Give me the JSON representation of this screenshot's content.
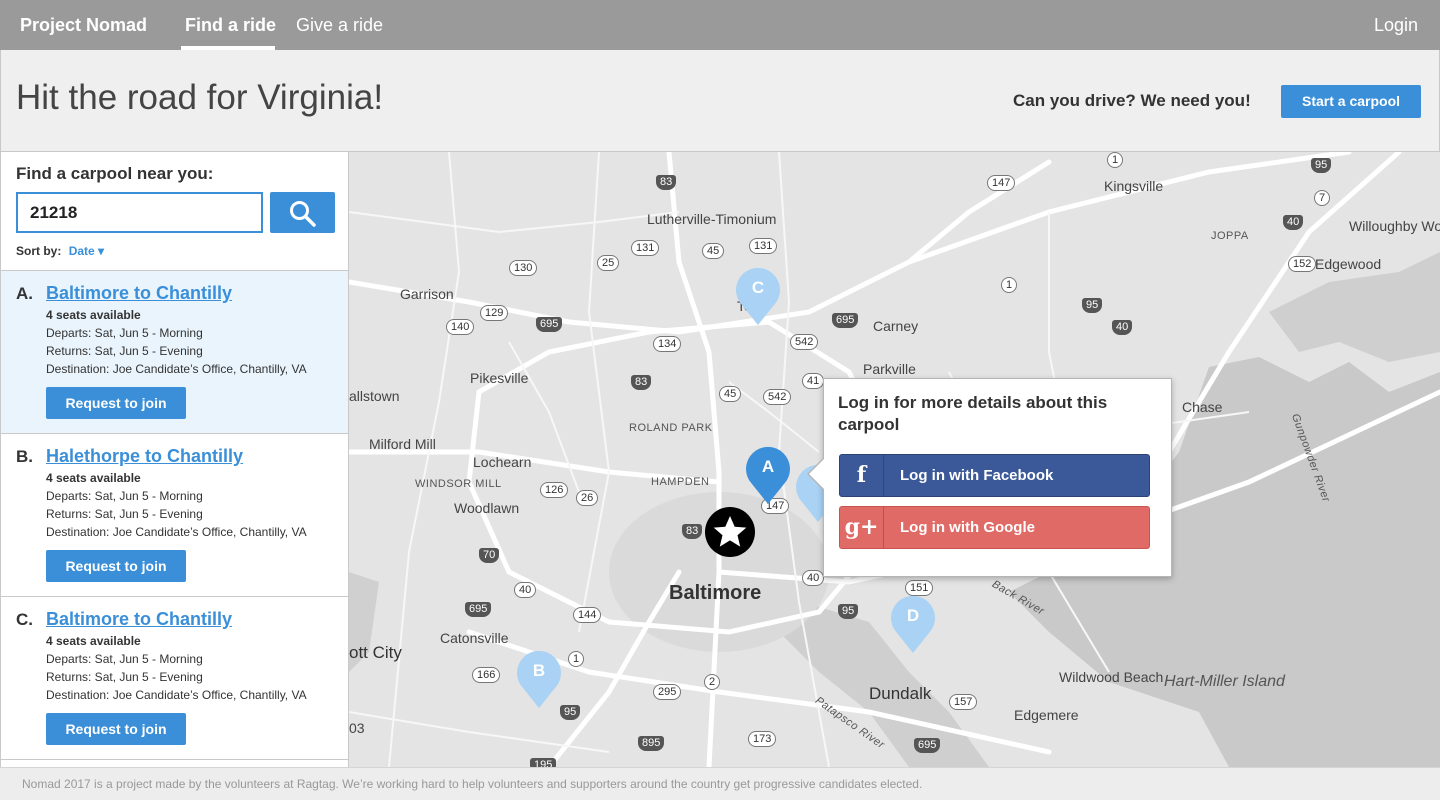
{
  "nav": {
    "brand": "Project Nomad",
    "find_ride": "Find a ride",
    "give_ride": "Give a ride",
    "login": "Login"
  },
  "hero": {
    "title": "Hit the road for Virginia!",
    "drive_prompt": "Can you drive? We need you!",
    "start_button": "Start a carpool"
  },
  "search": {
    "label": "Find a carpool near you:",
    "zip_value": "21218",
    "sort_label": "Sort by:",
    "sort_value": "Date ▾"
  },
  "carpools": [
    {
      "letter": "A.",
      "title": "Baltimore to Chantilly",
      "seats": "4 seats available",
      "departs": "Departs: Sat, Jun 5 - Morning",
      "returns": "Returns: Sat, Jun 5 - Evening",
      "destination": "Destination: Joe Candidate’s Office, Chantilly, VA",
      "button": "Request to join"
    },
    {
      "letter": "B.",
      "title": "Halethorpe to Chantilly",
      "seats": "4 seats available",
      "departs": "Departs: Sat, Jun 5 - Morning",
      "returns": "Returns: Sat, Jun 5 - Evening",
      "destination": "Destination: Joe Candidate’s Office, Chantilly, VA",
      "button": "Request to join"
    },
    {
      "letter": "C.",
      "title": "Baltimore to Chantilly",
      "seats": "4 seats available",
      "departs": "Departs: Sat, Jun 5 - Morning",
      "returns": "Returns: Sat, Jun 5 - Evening",
      "destination": "Destination: Joe Candidate’s Office, Chantilly, VA",
      "button": "Request to join"
    }
  ],
  "map": {
    "pins": [
      "A",
      "B",
      "C",
      "D"
    ],
    "places": {
      "lutherville": "Lutherville-Timonium",
      "kingsville": "Kingsville",
      "willoughby": "Willoughby Woods",
      "edgewood": "Edgewood",
      "joppa": "JOPPA",
      "garrison": "Garrison",
      "towson": "Tow",
      "carney": "Carney",
      "parkville": "Parkville",
      "pikesville": "Pikesville",
      "owings": "allstown",
      "milford": "Milford Mill",
      "lochearn": "Lochearn",
      "roland": "ROLAND PARK",
      "windsor": "WINDSOR MILL",
      "hampden": "HAMPDEN",
      "woodlawn": "Woodlawn",
      "baltimore": "Baltimore",
      "catonsville": "Catonsville",
      "ellicott": "ott City",
      "dundalk": "Dundalk",
      "wildwood": "Wildwood Beach",
      "edgemere": "Edgemere",
      "hartmiller": "Hart-Miller Island",
      "chase": "Chase",
      "backriver": "Back River",
      "gunpowder": "Gunpowder River",
      "patapsco": "Patapsco River"
    },
    "route_shields": [
      "83",
      "1",
      "147",
      "95",
      "7",
      "40",
      "131",
      "45",
      "131",
      "152",
      "130",
      "25",
      "1",
      "129",
      "695",
      "695",
      "95",
      "140",
      "134",
      "542",
      "41",
      "40",
      "83",
      "45",
      "542",
      "126",
      "26",
      "147",
      "83",
      "70",
      "40",
      "40",
      "695",
      "144",
      "95",
      "151",
      "166",
      "1",
      "295",
      "2",
      "95",
      "157",
      "895",
      "173",
      "695",
      "195",
      "03"
    ]
  },
  "popup": {
    "title": "Log in for more details about this carpool",
    "facebook": "Log in with Facebook",
    "google": "Log in with Google",
    "facebook_icon": "f",
    "google_icon": "g+"
  },
  "footer": {
    "text": "Nomad 2017 is a project made by the volunteers at Ragtag. We’re working hard to help volunteers and supporters around the country get progressive candidates elected."
  },
  "colors": {
    "accent": "#3a8fd8",
    "nav_bg": "#9a9a9a",
    "facebook": "#3b5998",
    "google": "#e06a66",
    "pin": "#a9d2f5",
    "pin_active": "#3a8fd8"
  }
}
